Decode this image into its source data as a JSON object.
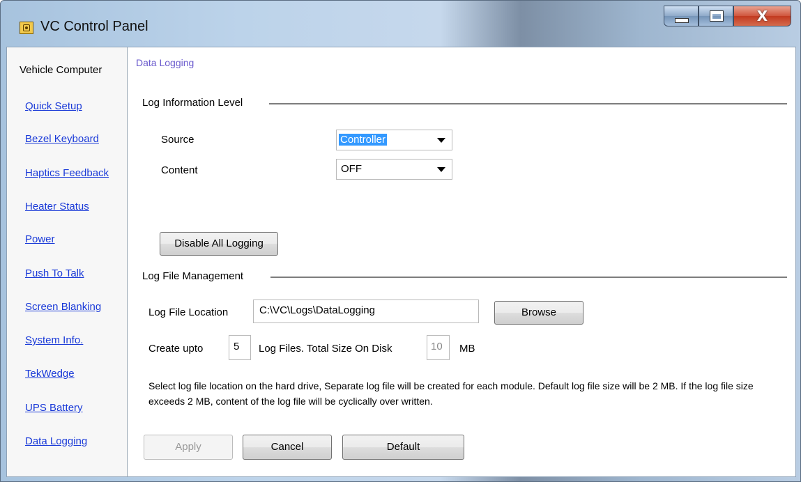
{
  "window": {
    "title": "VC Control Panel",
    "icon": "vc-app-icon",
    "controls": {
      "minimize_icon": "minimize-icon",
      "maximize_icon": "maximize-icon",
      "close_icon": "close-icon",
      "close_glyph": "X"
    }
  },
  "sidebar": {
    "header": "Vehicle Computer",
    "items": [
      {
        "label": "Quick Setup"
      },
      {
        "label": "Bezel Keyboard"
      },
      {
        "label": "Haptics Feedback"
      },
      {
        "label": "Heater Status"
      },
      {
        "label": "Power"
      },
      {
        "label": "Push To Talk"
      },
      {
        "label": "Screen Blanking"
      },
      {
        "label": "System Info."
      },
      {
        "label": "TekWedge"
      },
      {
        "label": "UPS Battery"
      },
      {
        "label": "Data Logging"
      }
    ]
  },
  "main": {
    "page_title": "Data Logging",
    "log_info": {
      "section_title": "Log Information Level",
      "source_label": "Source",
      "source_value": "Controller",
      "content_label": "Content",
      "content_value": "OFF",
      "disable_button": "Disable All Logging"
    },
    "log_file": {
      "section_title": "Log File Management",
      "location_label": "Log File Location",
      "location_value": "C:\\VC\\Logs\\DataLogging",
      "browse_button": "Browse",
      "create_label": "Create upto",
      "count_value": "5",
      "files_label": "Log Files.  Total Size On Disk",
      "size_value": "10",
      "size_unit": "MB",
      "note": "Select log file location on the hard drive, Separate log file will be created for each module. Default log file size will be 2 MB. If the log file size exceeds 2 MB, content of the log file will be cyclically over written."
    },
    "buttons": {
      "apply": "Apply",
      "cancel": "Cancel",
      "default": "Default"
    }
  }
}
